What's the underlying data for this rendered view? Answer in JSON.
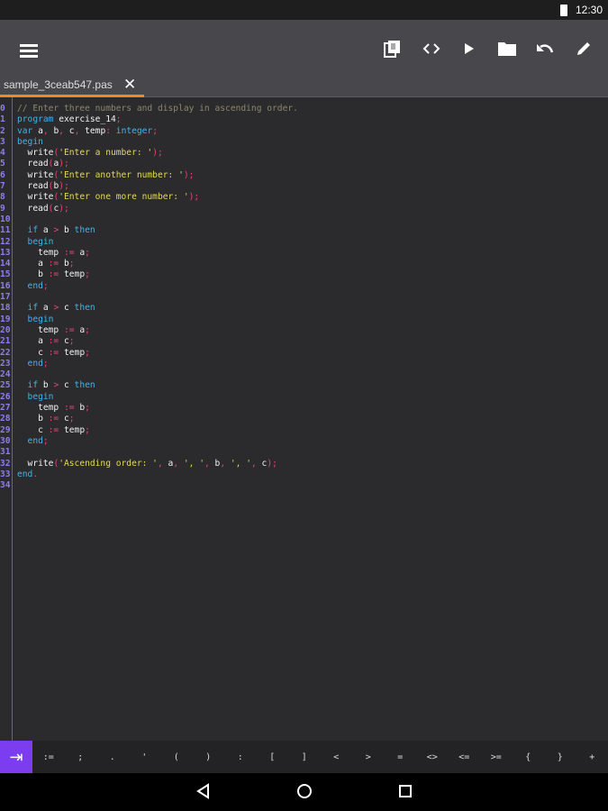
{
  "status": {
    "time": "12:30"
  },
  "toolbar": {
    "icons": [
      "menu-icon",
      "copy-icon",
      "code-icon",
      "run-icon",
      "folder-icon",
      "undo-icon",
      "edit-icon"
    ]
  },
  "tab": {
    "filename": "sample_3ceab547.pas",
    "close": "✕"
  },
  "colors": {
    "accent": "#7c3cf0",
    "tab_underline": "#f08a24",
    "keyword": "#3fb4e8",
    "string": "#e4d85a",
    "punct": "#e8456f",
    "comment": "#8a876c"
  },
  "code": [
    [
      [
        "c",
        "// Enter three numbers and display in ascending order."
      ]
    ],
    [
      [
        "k",
        "program"
      ],
      [
        "i",
        " exercise_14"
      ],
      [
        "p",
        ";"
      ]
    ],
    [
      [
        "k",
        "var"
      ],
      [
        "i",
        " a"
      ],
      [
        "p",
        ","
      ],
      [
        "i",
        " b"
      ],
      [
        "p",
        ","
      ],
      [
        "i",
        " c"
      ],
      [
        "p",
        ","
      ],
      [
        "i",
        " temp"
      ],
      [
        "p",
        ":"
      ],
      [
        "k",
        " integer"
      ],
      [
        "p",
        ";"
      ]
    ],
    [
      [
        "k",
        "begin"
      ]
    ],
    [
      [
        "i",
        "  write"
      ],
      [
        "p",
        "("
      ],
      [
        "s",
        "'Enter a number: '"
      ],
      [
        "p",
        ");"
      ]
    ],
    [
      [
        "i",
        "  read"
      ],
      [
        "p",
        "("
      ],
      [
        "i",
        "a"
      ],
      [
        "p",
        ");"
      ]
    ],
    [
      [
        "i",
        "  write"
      ],
      [
        "p",
        "("
      ],
      [
        "s",
        "'Enter another number: '"
      ],
      [
        "p",
        ");"
      ]
    ],
    [
      [
        "i",
        "  read"
      ],
      [
        "p",
        "("
      ],
      [
        "i",
        "b"
      ],
      [
        "p",
        ");"
      ]
    ],
    [
      [
        "i",
        "  write"
      ],
      [
        "p",
        "("
      ],
      [
        "s",
        "'Enter one more number: '"
      ],
      [
        "p",
        ");"
      ]
    ],
    [
      [
        "i",
        "  read"
      ],
      [
        "p",
        "("
      ],
      [
        "i",
        "c"
      ],
      [
        "p",
        ");"
      ]
    ],
    [],
    [
      [
        "k",
        "  if"
      ],
      [
        "i",
        " a "
      ],
      [
        "p",
        ">"
      ],
      [
        "i",
        " b "
      ],
      [
        "k",
        "then"
      ]
    ],
    [
      [
        "k",
        "  begin"
      ]
    ],
    [
      [
        "i",
        "    temp "
      ],
      [
        "p",
        ":="
      ],
      [
        "i",
        " a"
      ],
      [
        "p",
        ";"
      ]
    ],
    [
      [
        "i",
        "    a "
      ],
      [
        "p",
        ":="
      ],
      [
        "i",
        " b"
      ],
      [
        "p",
        ";"
      ]
    ],
    [
      [
        "i",
        "    b "
      ],
      [
        "p",
        ":="
      ],
      [
        "i",
        " temp"
      ],
      [
        "p",
        ";"
      ]
    ],
    [
      [
        "k",
        "  end"
      ],
      [
        "p",
        ";"
      ]
    ],
    [],
    [
      [
        "k",
        "  if"
      ],
      [
        "i",
        " a "
      ],
      [
        "p",
        ">"
      ],
      [
        "i",
        " c "
      ],
      [
        "k",
        "then"
      ]
    ],
    [
      [
        "k",
        "  begin"
      ]
    ],
    [
      [
        "i",
        "    temp "
      ],
      [
        "p",
        ":="
      ],
      [
        "i",
        " a"
      ],
      [
        "p",
        ";"
      ]
    ],
    [
      [
        "i",
        "    a "
      ],
      [
        "p",
        ":="
      ],
      [
        "i",
        " c"
      ],
      [
        "p",
        ";"
      ]
    ],
    [
      [
        "i",
        "    c "
      ],
      [
        "p",
        ":="
      ],
      [
        "i",
        " temp"
      ],
      [
        "p",
        ";"
      ]
    ],
    [
      [
        "k",
        "  end"
      ],
      [
        "p",
        ";"
      ]
    ],
    [],
    [
      [
        "k",
        "  if"
      ],
      [
        "i",
        " b "
      ],
      [
        "p",
        ">"
      ],
      [
        "i",
        " c "
      ],
      [
        "k",
        "then"
      ]
    ],
    [
      [
        "k",
        "  begin"
      ]
    ],
    [
      [
        "i",
        "    temp "
      ],
      [
        "p",
        ":="
      ],
      [
        "i",
        " b"
      ],
      [
        "p",
        ";"
      ]
    ],
    [
      [
        "i",
        "    b "
      ],
      [
        "p",
        ":="
      ],
      [
        "i",
        " c"
      ],
      [
        "p",
        ";"
      ]
    ],
    [
      [
        "i",
        "    c "
      ],
      [
        "p",
        ":="
      ],
      [
        "i",
        " temp"
      ],
      [
        "p",
        ";"
      ]
    ],
    [
      [
        "k",
        "  end"
      ],
      [
        "p",
        ";"
      ]
    ],
    [],
    [
      [
        "i",
        "  write"
      ],
      [
        "p",
        "("
      ],
      [
        "s",
        "'Ascending order: '"
      ],
      [
        "p",
        ","
      ],
      [
        "i",
        " a"
      ],
      [
        "p",
        ","
      ],
      [
        "s",
        " ', '"
      ],
      [
        "p",
        ","
      ],
      [
        "i",
        " b"
      ],
      [
        "p",
        ","
      ],
      [
        "s",
        " ', '"
      ],
      [
        "p",
        ","
      ],
      [
        "i",
        " c"
      ],
      [
        "p",
        ");"
      ]
    ],
    [
      [
        "k",
        "end"
      ],
      [
        "p",
        "."
      ]
    ],
    []
  ],
  "symbols": {
    "tab_key": "⇥",
    "keys": [
      ":=",
      ";",
      ".",
      "'",
      "(",
      ")",
      ":",
      "[",
      "]",
      "<",
      ">",
      "=",
      "<>",
      "<=",
      ">=",
      "{",
      "}",
      "+"
    ]
  }
}
